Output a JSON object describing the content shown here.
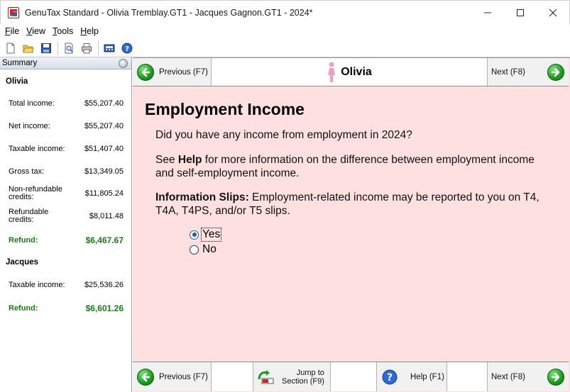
{
  "window": {
    "title": "GenuTax Standard - Olivia Tremblay.GT1 - Jacques Gagnon.GT1 - 2024*",
    "minimize": "—",
    "maximize": "☐",
    "close": "✕"
  },
  "menu": [
    {
      "label": "File",
      "accel": "F",
      "rest": "ile"
    },
    {
      "label": "View",
      "accel": "V",
      "rest": "iew"
    },
    {
      "label": "Tools",
      "accel": "T",
      "rest": "ools"
    },
    {
      "label": "Help",
      "accel": "H",
      "rest": "elp"
    }
  ],
  "toolbar_icons": [
    "new-file-icon",
    "open-folder-icon",
    "save-icon",
    "print-preview-icon",
    "print-icon",
    "calculator-icon",
    "help-icon"
  ],
  "summary": {
    "header": "Summary",
    "people": [
      {
        "name": "Olivia",
        "rows": [
          {
            "label": "Total income:",
            "value": "$55,207.40"
          },
          {
            "label": "Net income:",
            "value": "$55,207.40"
          },
          {
            "label": "Taxable income:",
            "value": "$51,407.40"
          },
          {
            "label": "Gross tax:",
            "value": "$13,349.05"
          },
          {
            "label": "Non-refundable credits:",
            "value": "$11,805.24"
          },
          {
            "label": "Refundable credits:",
            "value": "$8,011.48"
          },
          {
            "label": "Refund:",
            "value": "$6,467.67"
          }
        ]
      },
      {
        "name": "Jacques",
        "rows": [
          {
            "label": "Taxable income:",
            "value": "$25,536.26"
          },
          {
            "label": "Refund:",
            "value": "$6,601.26"
          }
        ]
      }
    ]
  },
  "nav": {
    "previous": "Previous (F7)",
    "next": "Next (F8)",
    "person": "Olivia",
    "person_icon": "female-person-icon"
  },
  "content": {
    "title": "Employment Income",
    "question": "Did you have any income from employment in 2024?",
    "help_prefix": "See ",
    "help_bold": "Help",
    "help_rest": " for more information on the difference between employment income and self-employment income.",
    "slips_bold": "Information Slips:",
    "slips_rest": " Employment-related income may be reported to you on T4, T4A, T4PS, and/or T5 slips.",
    "options": [
      {
        "label": "Yes",
        "selected": true
      },
      {
        "label": "No",
        "selected": false
      }
    ]
  },
  "footer": {
    "previous": "Previous (F7)",
    "jump_line1": "Jump to",
    "jump_line2": "Section (F9)",
    "help": "Help (F1)",
    "next": "Next (F8)"
  },
  "colors": {
    "content_bg": "#fde0df",
    "refund_green": "#1a7a1a",
    "nav_green": "#1d9b1d"
  }
}
